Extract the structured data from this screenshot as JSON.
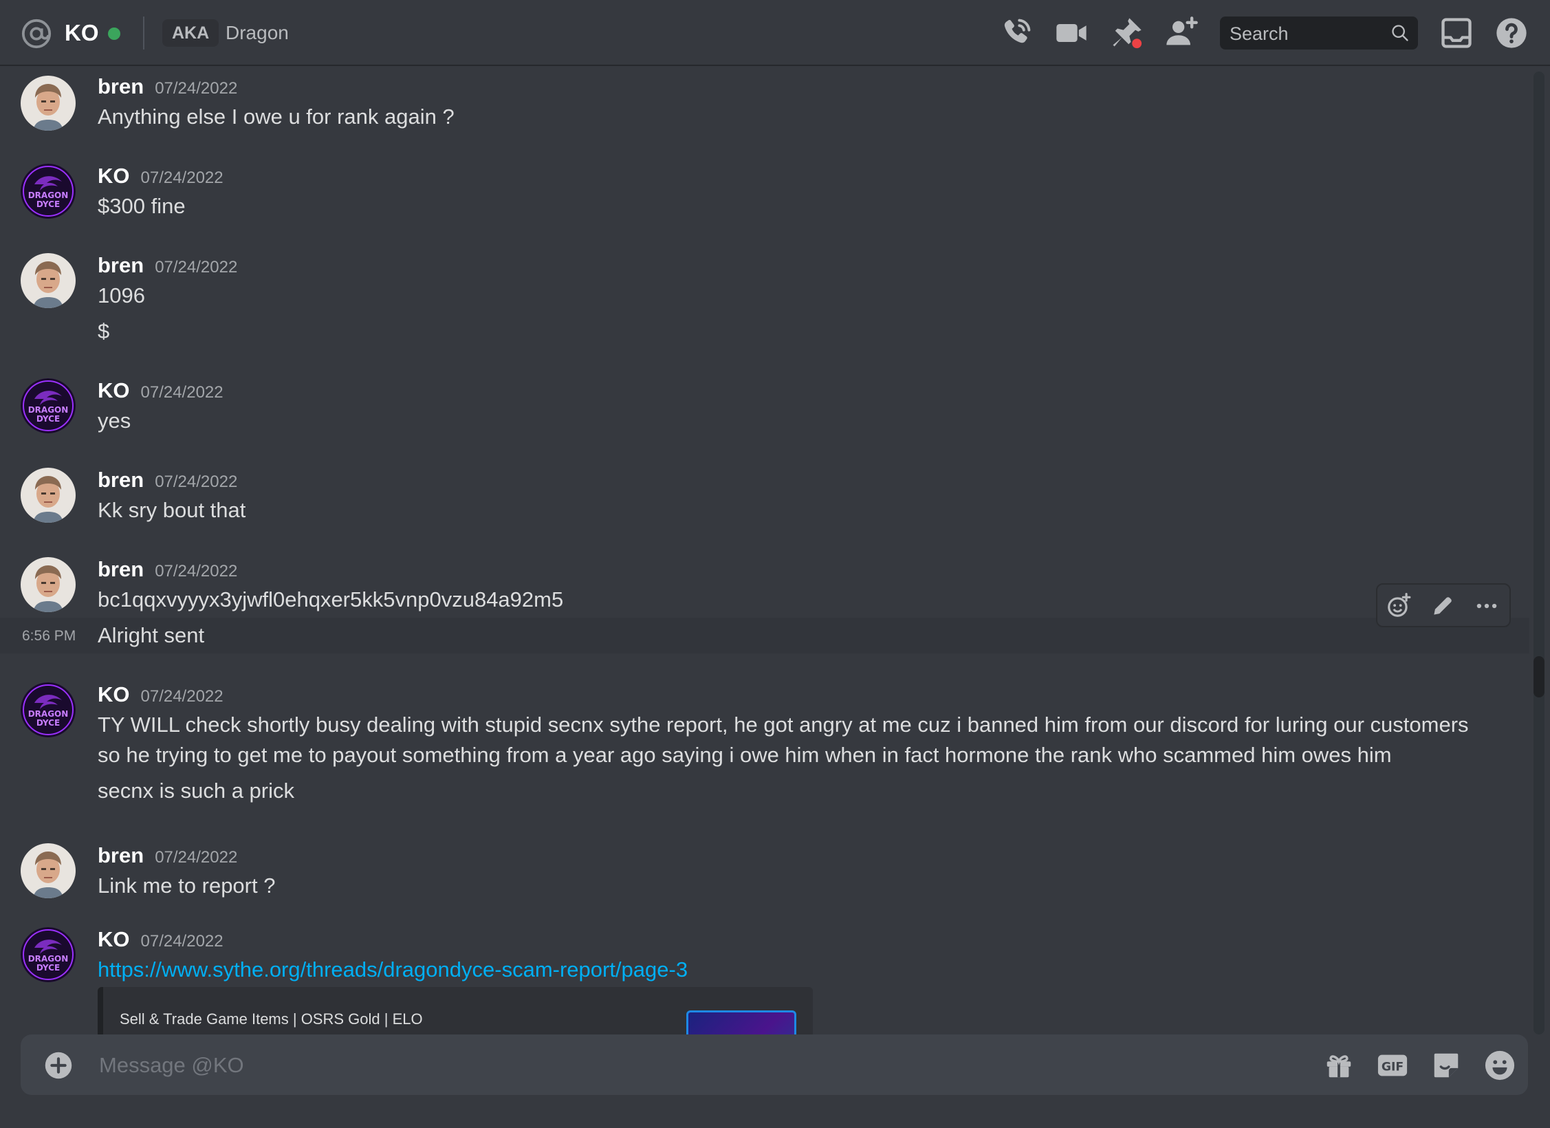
{
  "header": {
    "name": "KO",
    "aka_label": "AKA",
    "aka_name": "Dragon",
    "search_placeholder": "Search",
    "colors": {
      "online": "#3ba55c",
      "background": "#36393f"
    },
    "icons": [
      "at-icon",
      "voice-call-icon",
      "video-call-icon",
      "pinned-messages-icon",
      "add-friend-icon",
      "search-icon",
      "inbox-icon",
      "help-icon"
    ]
  },
  "messages": [
    {
      "author": "bren",
      "date": "07/24/2022",
      "lines": [
        "Anything else I owe u for rank again ?"
      ]
    },
    {
      "author": "KO",
      "date": "07/24/2022",
      "lines": [
        "$300 fine"
      ]
    },
    {
      "author": "bren",
      "date": "07/24/2022",
      "lines": [
        "1096",
        "$"
      ]
    },
    {
      "author": "KO",
      "date": "07/24/2022",
      "lines": [
        "yes"
      ]
    },
    {
      "author": "bren",
      "date": "07/24/2022",
      "lines": [
        "Kk sry bout that"
      ]
    },
    {
      "author": "bren",
      "date": "07/24/2022",
      "lines": [
        "bc1qqxvyyyx3yjwfl0ehqxer5kk5vnp0vzu84a92m5"
      ],
      "followup": {
        "time": "6:56 PM",
        "text": "Alright sent"
      }
    },
    {
      "author": "KO",
      "date": "07/24/2022",
      "lines": [
        "TY WILL check shortly  busy dealing with stupid secnx  sythe report, he got angry at me cuz i banned him from our discord for luring our customers",
        "so he trying to get me to payout something from a year ago saying i owe him when in fact hormone the rank who scammed him owes him",
        "secnx is such a prick"
      ]
    },
    {
      "author": "bren",
      "date": "07/24/2022",
      "lines": [
        "Link me to report ?"
      ]
    },
    {
      "author": "KO",
      "date": "07/24/2022",
      "link": "https://www.sythe.org/threads/dragondyce-scam-report/page-3",
      "embed": {
        "provider": "Sell & Trade Game Items | OSRS Gold | ELO"
      }
    }
  ],
  "avatar_text": {
    "line1": "DRAGON",
    "line2": "DYCE"
  },
  "toolbar": {
    "icons": [
      "add-reaction-icon",
      "edit-icon",
      "more-icon"
    ]
  },
  "composer": {
    "placeholder": "Message @KO",
    "icons": [
      "attach-plus-icon",
      "gift-icon",
      "gif-icon",
      "sticker-icon",
      "emoji-icon"
    ],
    "gif_label": "GIF"
  }
}
